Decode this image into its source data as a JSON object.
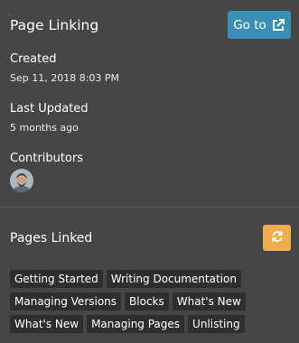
{
  "header": {
    "title": "Page Linking",
    "goto_label": "Go to",
    "goto_icon": "external-link-icon",
    "goto_color": "#3b8fb5"
  },
  "meta": {
    "created_label": "Created",
    "created_value": "Sep 11, 2018 8:03 PM",
    "updated_label": "Last Updated",
    "updated_value": "5 months ago",
    "contributors_label": "Contributors"
  },
  "pages_linked": {
    "title": "Pages Linked",
    "refresh_icon": "refresh-icon",
    "refresh_color": "#f0ad4e",
    "tags": [
      "Getting Started",
      "Writing Documentation",
      "Managing Versions",
      "Blocks",
      "What's New",
      "What's New",
      "Managing Pages",
      "Unlisting"
    ]
  },
  "colors": {
    "background": "#464646",
    "tag_background": "#2e2e2e"
  }
}
